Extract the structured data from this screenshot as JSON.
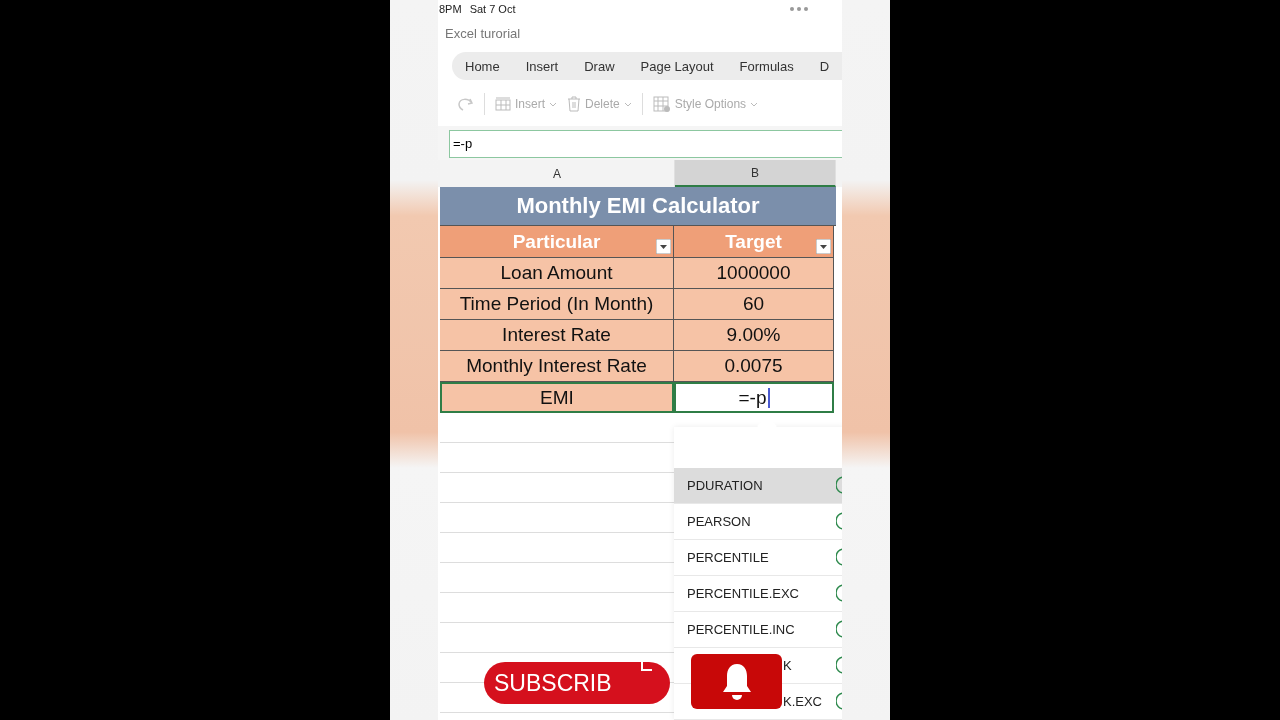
{
  "status_bar": {
    "time": "8PM",
    "date": "Sat 7 Oct"
  },
  "document_title": "Excel turorial",
  "ribbon_tabs": [
    {
      "label": "Home"
    },
    {
      "label": "Insert"
    },
    {
      "label": "Draw"
    },
    {
      "label": "Page Layout"
    },
    {
      "label": "Formulas"
    },
    {
      "label": "D"
    }
  ],
  "toolbar": [
    {
      "kind": "redo"
    },
    {
      "kind": "insert",
      "label": "Insert"
    },
    {
      "kind": "delete",
      "label": "Delete"
    },
    {
      "kind": "style",
      "label": "Style Options"
    }
  ],
  "formula_bar": {
    "value": "=-p"
  },
  "columns": [
    {
      "label": "A",
      "selected": false
    },
    {
      "label": "B",
      "selected": true
    }
  ],
  "sheet": {
    "title": "Monthly EMI Calculator",
    "headers": [
      "Particular",
      "Target"
    ],
    "rows": [
      {
        "label": "Loan Amount",
        "value": "1000000",
        "editing": false
      },
      {
        "label": "Time Period (In Month)",
        "value": "60",
        "editing": false
      },
      {
        "label": "Interest Rate",
        "value": "9.00%",
        "editing": false
      },
      {
        "label": "Monthly Interest Rate",
        "value": "0.0075",
        "editing": false
      },
      {
        "label": "EMI",
        "value": "=-p",
        "editing": true
      }
    ]
  },
  "autocomplete": [
    {
      "label": "PDURATION",
      "selected": true
    },
    {
      "label": "PEARSON",
      "selected": false
    },
    {
      "label": "PERCENTILE",
      "selected": false
    },
    {
      "label": "PERCENTILE.EXC",
      "selected": false
    },
    {
      "label": "PERCENTILE.INC",
      "selected": false
    },
    {
      "label_end": "K",
      "selected": false
    },
    {
      "label_end": "K.EXC",
      "selected": false
    }
  ],
  "subscribe_button": "SUBSCRIB"
}
